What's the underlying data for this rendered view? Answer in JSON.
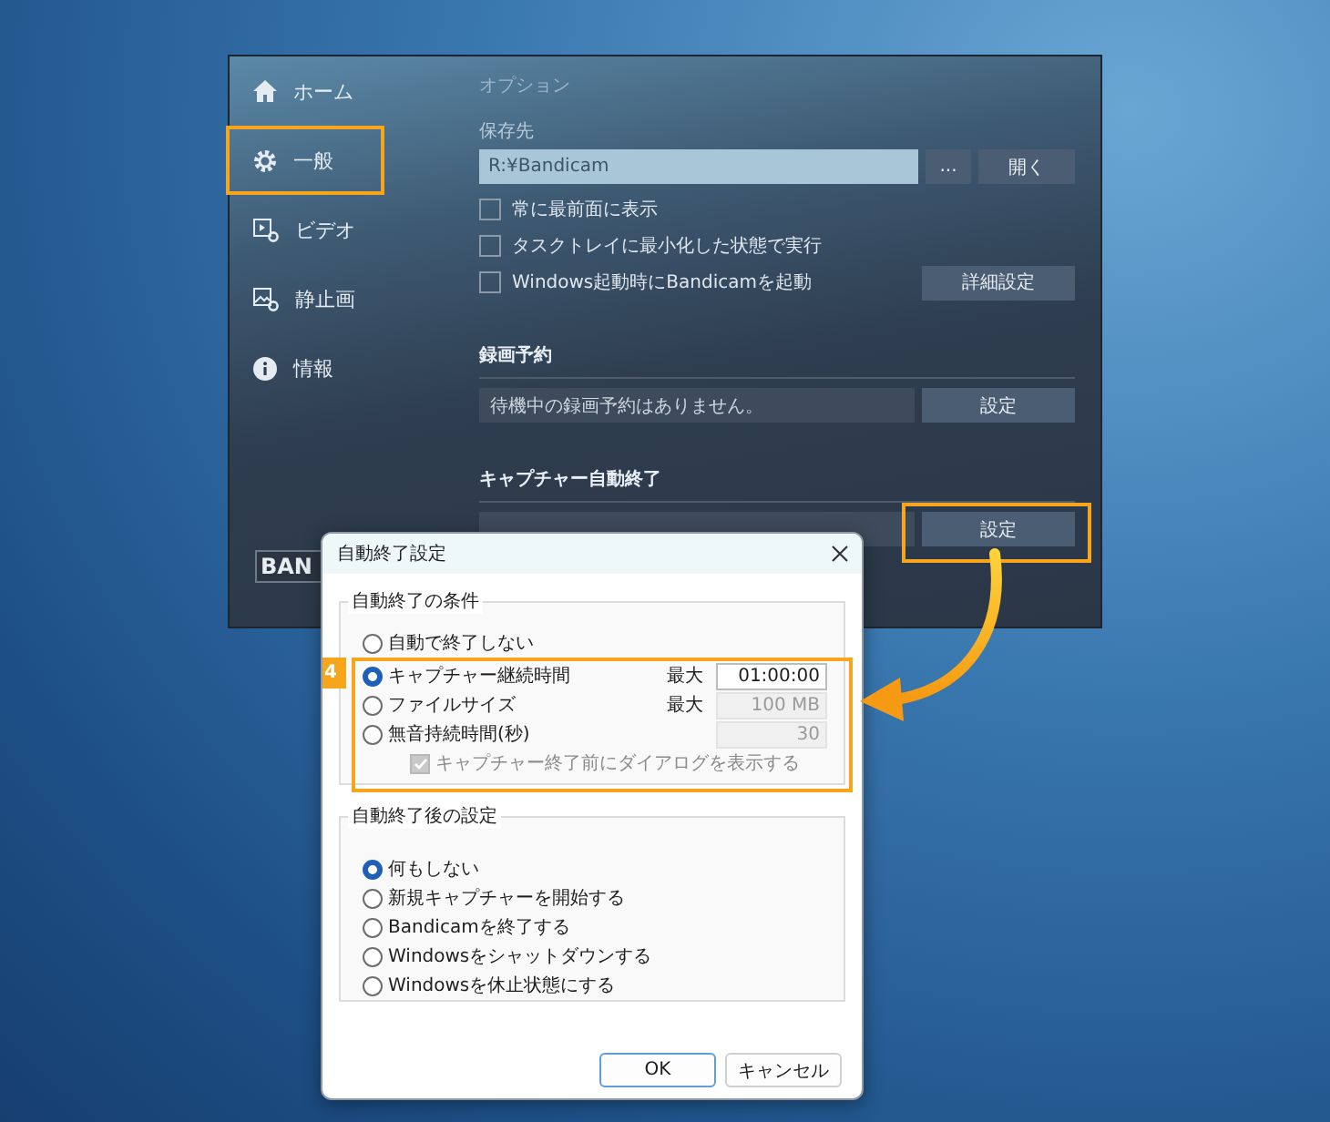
{
  "app_window": {
    "sidebar": [
      {
        "label": "ホーム",
        "selected": false
      },
      {
        "label": "一般",
        "selected": true
      },
      {
        "label": "ビデオ",
        "selected": false
      },
      {
        "label": "静止画",
        "selected": false
      },
      {
        "label": "情報",
        "selected": false
      }
    ],
    "logo": "BAN",
    "options_title": "オプション",
    "save_folder": {
      "label": "保存先",
      "path": "R:¥Bandicam",
      "browse_button": "...",
      "open_button": "開く"
    },
    "checkboxes": [
      {
        "label": "常に最前面に表示",
        "checked": false
      },
      {
        "label": "タスクトレイに最小化した状態で実行",
        "checked": false
      },
      {
        "label": "Windows起動時にBandicamを起動",
        "checked": false
      }
    ],
    "advanced_button": "詳細設定",
    "schedule": {
      "title": "録画予約",
      "status": "待機中の録画予約はありません。",
      "button": "設定"
    },
    "auto_complete": {
      "title": "キャプチャー自動終了",
      "button": "設定",
      "highlighted": true
    }
  },
  "dialog": {
    "title": "自動終了設定",
    "conditions": {
      "title": "自動終了の条件",
      "badge": "4",
      "options": [
        {
          "label": "自動で終了しない",
          "selected": false,
          "highlighted": false
        },
        {
          "label": "キャプチャー継続時間",
          "selected": true,
          "highlighted": true,
          "limit_label": "最大",
          "value": "01:00:00",
          "disabled": false
        },
        {
          "label": "ファイルサイズ",
          "selected": false,
          "highlighted": true,
          "limit_label": "最大",
          "value": "100 MB",
          "disabled": true
        },
        {
          "label": "無音持続時間(秒)",
          "selected": false,
          "highlighted": true,
          "value": "30",
          "disabled": true
        }
      ],
      "confirm": {
        "label": "キャプチャー終了前にダイアログを表示する",
        "checked": true,
        "disabled": true
      }
    },
    "after": {
      "title": "自動終了後の設定",
      "options": [
        {
          "label": "何もしない",
          "selected": true
        },
        {
          "label": "新規キャプチャーを開始する",
          "selected": false
        },
        {
          "label": "Bandicamを終了する",
          "selected": false
        },
        {
          "label": "Windowsをシャットダウンする",
          "selected": false
        },
        {
          "label": "Windowsを休止状態にする",
          "selected": false
        }
      ]
    },
    "buttons": {
      "ok": "OK",
      "cancel": "キャンセル"
    }
  }
}
